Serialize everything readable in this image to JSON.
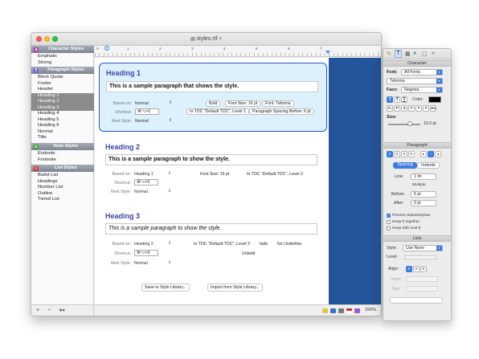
{
  "window": {
    "title": "styles.rtf"
  },
  "sidebar": {
    "character_styles": {
      "title": "Character Styles",
      "items": [
        "Emphatic",
        "Strong"
      ]
    },
    "paragraph_styles": {
      "title": "Paragraph Styles",
      "items": [
        "Block Quote",
        "Footer",
        "Header",
        "Heading 1",
        "Heading 2",
        "Heading 3",
        "Heading 4",
        "Heading 5",
        "Heading 6",
        "Normal",
        "Title"
      ]
    },
    "note_styles": {
      "title": "Note Styles",
      "items": [
        "Endnote",
        "Footnote"
      ]
    },
    "list_styles": {
      "title": "List Styles",
      "items": [
        "Bullet List",
        "Headings",
        "Number List",
        "Outline",
        "Tiered List"
      ]
    },
    "bottom": {
      "add": "+",
      "remove": "−",
      "action": "✲▾"
    }
  },
  "ruler": {
    "numbers": [
      "0",
      "1",
      "2",
      "3",
      "4",
      "5",
      "6",
      "7"
    ]
  },
  "styles": [
    {
      "heading": "Heading 1",
      "sample": "This is a sample paragraph that shows the style.",
      "based_on_label": "Based on:",
      "based_on": "Normal",
      "shortcut_label": "Shortcut:",
      "shortcut": "⌘⌥=1",
      "next_label": "Next Style:",
      "next": "Normal",
      "tags": [
        "Bold",
        "Font Size: 16 pt",
        "Font: Tahoma",
        "In TOC \"Default TOC\", Level 1",
        "Paragraph Spacing Before: 6 pt"
      ]
    },
    {
      "heading": "Heading 2",
      "sample": "This is a sample paragraph to show the style.",
      "based_on_label": "Based on:",
      "based_on": "Heading 1",
      "shortcut_label": "Shortcut:",
      "shortcut": "⌘⌥=2",
      "next_label": "Next Style:",
      "next": "Normal",
      "tags": [
        "Font Size: 15 pt",
        "In TOC \"Default TOC\", Level 2"
      ]
    },
    {
      "heading": "Heading 3",
      "sample": "This is a sample paragraph to show the style.",
      "based_on_label": "Based on:",
      "based_on": "Heading 2",
      "shortcut_label": "Shortcut:",
      "shortcut": "⌘⌥=3",
      "next_label": "Next Style:",
      "next": "Normal",
      "tags": [
        "In TOC \"Default TOC\", Level 3",
        "Italic",
        "No Underline",
        "Unbold"
      ]
    }
  ],
  "footer_buttons": {
    "save": "Save to Style Library...",
    "import": "Import from Style Library..."
  },
  "status": {
    "zoom": "100%"
  },
  "inspector": {
    "character": {
      "title": "Character",
      "font_label": "Font:",
      "font_collection": "All Fonts",
      "font_family": "Tahoma",
      "face_label": "Face:",
      "face": "Negreta",
      "color_label": "Color:",
      "size_label": "Size:",
      "size": "16.0 pt"
    },
    "paragraph": {
      "title": "Paragraph",
      "tab_spacing": "Spacing",
      "tab_indents": "Indents",
      "line_label": "Line:",
      "line_value": "1 lin",
      "line_mode": "Multiple",
      "before_label": "Before:",
      "before_value": "6 pt",
      "after_label": "After:",
      "after_value": "0 pt",
      "checks": [
        "Prevent widow/orphan",
        "Keep ¶ together",
        "Keep with next ¶"
      ],
      "checked": [
        true,
        false,
        false
      ]
    },
    "lists": {
      "title": "Lists",
      "style_label": "Style:",
      "style": "Use None",
      "level_label": "Level:",
      "align_label": "Align:",
      "num_label": "Num:",
      "text_label": "Text:"
    }
  }
}
